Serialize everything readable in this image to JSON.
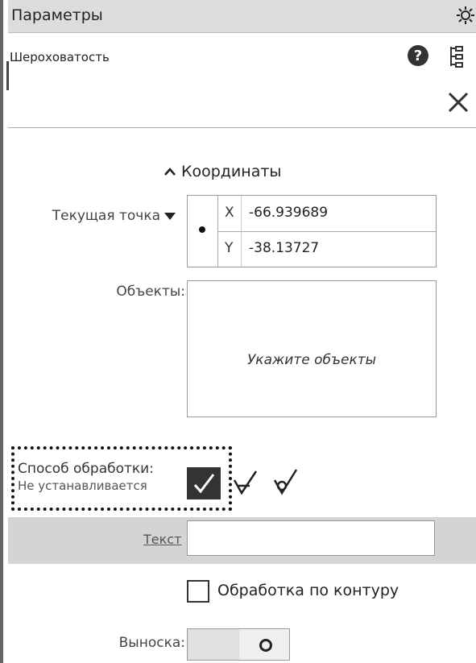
{
  "panel": {
    "title": "Параметры",
    "subtitle": "Шероховатость"
  },
  "coordinates": {
    "section_title": "Координаты",
    "current_point_label": "Текущая точка",
    "x_axis": "X",
    "x_value": "-66.939689",
    "y_axis": "Y",
    "y_value": "-38.13727"
  },
  "objects": {
    "label": "Объекты:",
    "hint": "Укажите объекты"
  },
  "processing": {
    "label": "Способ обработки:",
    "value": "Не устанавливается"
  },
  "text_field": {
    "link": "Текст",
    "value": ""
  },
  "contour": {
    "label": "Обработка по контуру",
    "checked": false
  },
  "leader": {
    "label": "Выноска:"
  },
  "colors": {
    "title_bg": "#dcdcdc",
    "text_row_bg": "#d4d4d4",
    "selected_check_bg": "#333333"
  }
}
